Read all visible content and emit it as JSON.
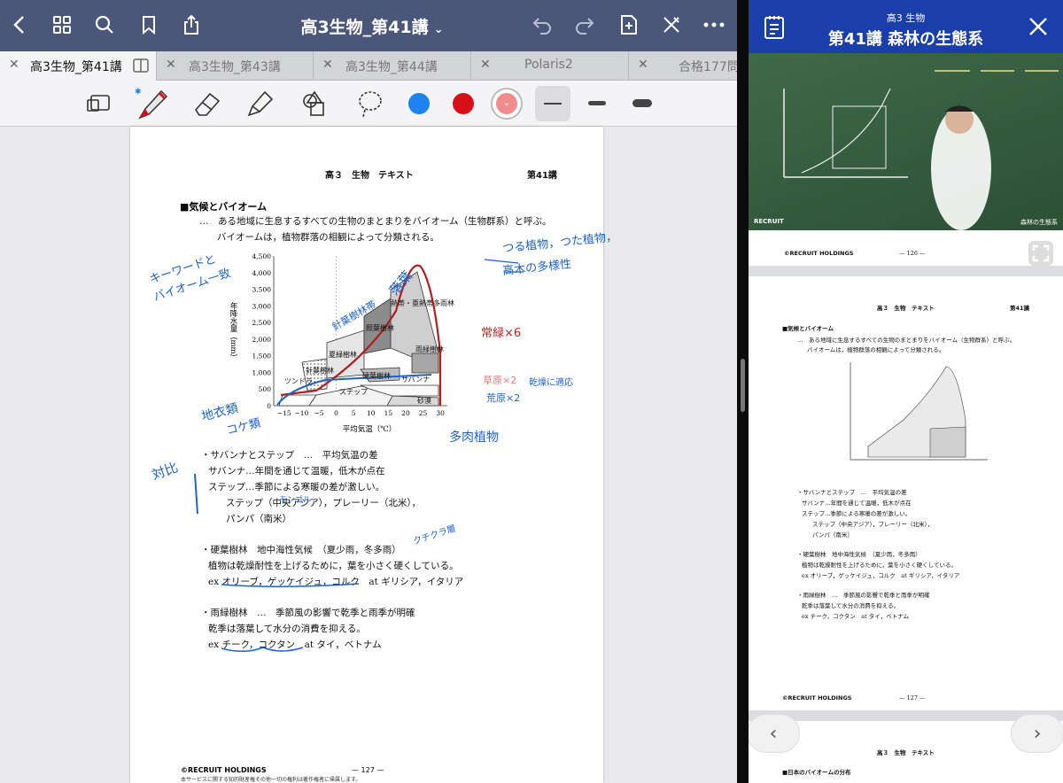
{
  "topbar": {
    "title": "高3生物_第41講",
    "title_chevron": "⌄"
  },
  "tabs": [
    {
      "label": "高3生物_第41講",
      "active": true
    },
    {
      "label": "高3生物_第43講"
    },
    {
      "label": "高3生物_第44講"
    },
    {
      "label": "Polaris2"
    },
    {
      "label": "合格177問"
    }
  ],
  "tab_close": "✕",
  "colors": {
    "blue": "#1e82f0",
    "red": "#d70f19",
    "pink": "#f08c8c",
    "accent": "#4a577a",
    "panel": "#1b3faa"
  },
  "page": {
    "header_left": "高３　生物　テキスト",
    "header_right": "第41講",
    "section_title": "■気候とバイオーム",
    "intro1": "…　ある地域に生息するすべての生物のまとまりをバイオーム（生物群系）と呼ぶ。",
    "intro2": "バイオームは，植物群落の相観によって分類される。",
    "lines": [
      "・サバンナとステップ　…　平均気温の差",
      "サバンナ…年間を通じて温暖，低木が点在",
      "ステップ…季節による寒暖の差が激しい。",
      "ステップ（中央アジア），プレーリー（北米），",
      "パンパ（南米）",
      "・硬葉樹林　地中海性気候　（夏少雨，冬多雨）",
      "植物は乾燥耐性を上げるために，葉を小さく硬くしている。",
      "ex オリーブ，ゲッケイジュ，コルク　at ギリシア，イタリア",
      "・雨緑樹林　…　季節風の影響で乾季と雨季が明確",
      "乾季は落葉して水分の消費を抑える。",
      "ex チーク，コクタン　at タイ，ベトナム"
    ],
    "footer_company": "©RECRUIT HOLDINGS",
    "footer_note": "本サービスに関する知的財産権その他一切の権利は著作権者に帰属します。",
    "page_number": "— 127 —"
  },
  "chart_data": {
    "type": "area",
    "title": "",
    "xlabel": "平均気温（℃）",
    "ylabel": "年降水量（mm）",
    "x_ticks": [
      "−15",
      "−10",
      "−5",
      "0",
      "5",
      "10",
      "15",
      "20",
      "25",
      "30"
    ],
    "y_ticks": [
      "0",
      "500",
      "1,000",
      "1,500",
      "2,000",
      "2,500",
      "3,000",
      "3,500",
      "4,000",
      "4,500"
    ],
    "xlim": [
      -18,
      32
    ],
    "ylim": [
      0,
      4500
    ],
    "regions": [
      "ツンドラ",
      "針葉樹林",
      "夏緑樹林",
      "照葉樹林",
      "熱帯・亜熱帯多雨林",
      "雨緑樹林",
      "硬葉樹林",
      "ステップ",
      "サバンナ",
      "砂漠"
    ]
  },
  "handwriting": {
    "keyword": "キーワードと",
    "biome": "バイオーム一致",
    "deciduous": "落葉",
    "conifer": "針葉樹林帯",
    "evergreen": "常緑×6",
    "vines": "つる植物，つた植物，",
    "tall": "高木の多様性",
    "contrast": "対比",
    "grass": "草原×2",
    "desert": "荒原×2",
    "dry": "乾燥に適応",
    "succulent": "多肉植物",
    "soil": "地衣類",
    "moss": "コケ類",
    "mongol": "モンゴル",
    "cicada": "クチクラ層"
  },
  "right": {
    "subtitle": "高3 生物",
    "title": "第41講 森林の生態系",
    "video_brand": "RECRUIT",
    "video_caption": "森林の生態系",
    "prev_footer_company": "©RECRUIT HOLDINGS",
    "prev_page_number": "— 126 —",
    "header_left": "高３　生物　テキスト",
    "header_right": "第41講",
    "section_title": "■気候とバイオーム",
    "intro1": "…　ある地域に生息するすべての生物のまとまりをバイオーム（生物群系）と呼ぶ。",
    "intro2": "バイオームは，植物群落の相観によって分類される。",
    "footer_company": "©RECRUIT HOLDINGS",
    "page_number": "— 127 —",
    "next_header": "高３　生物　テキスト",
    "next_section": "■日本のバイオームの分布"
  }
}
